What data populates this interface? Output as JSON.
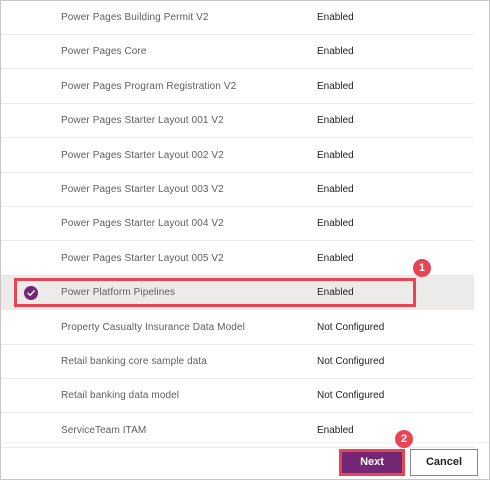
{
  "solutions": [
    {
      "name": "Power Pages Building Permit V2",
      "status": "Enabled"
    },
    {
      "name": "Power Pages Core",
      "status": "Enabled"
    },
    {
      "name": "Power Pages Program Registration V2",
      "status": "Enabled"
    },
    {
      "name": "Power Pages Starter Layout 001 V2",
      "status": "Enabled"
    },
    {
      "name": "Power Pages Starter Layout 002 V2",
      "status": "Enabled"
    },
    {
      "name": "Power Pages Starter Layout 003 V2",
      "status": "Enabled"
    },
    {
      "name": "Power Pages Starter Layout 004 V2",
      "status": "Enabled"
    },
    {
      "name": "Power Pages Starter Layout 005 V2",
      "status": "Enabled"
    },
    {
      "name": "Power Platform Pipelines",
      "status": "Enabled",
      "selected": true
    },
    {
      "name": "Property Casualty Insurance Data Model",
      "status": "Not Configured"
    },
    {
      "name": "Retail banking core sample data",
      "status": "Not Configured"
    },
    {
      "name": "Retail banking data model",
      "status": "Not Configured"
    },
    {
      "name": "ServiceTeam ITAM",
      "status": "Enabled"
    }
  ],
  "annotations": {
    "step1": "1",
    "step2": "2"
  },
  "footer": {
    "next_label": "Next",
    "cancel_label": "Cancel"
  },
  "colors": {
    "accent": "#742774",
    "annotation": "#e64553",
    "selected_row": "#edebe9"
  }
}
